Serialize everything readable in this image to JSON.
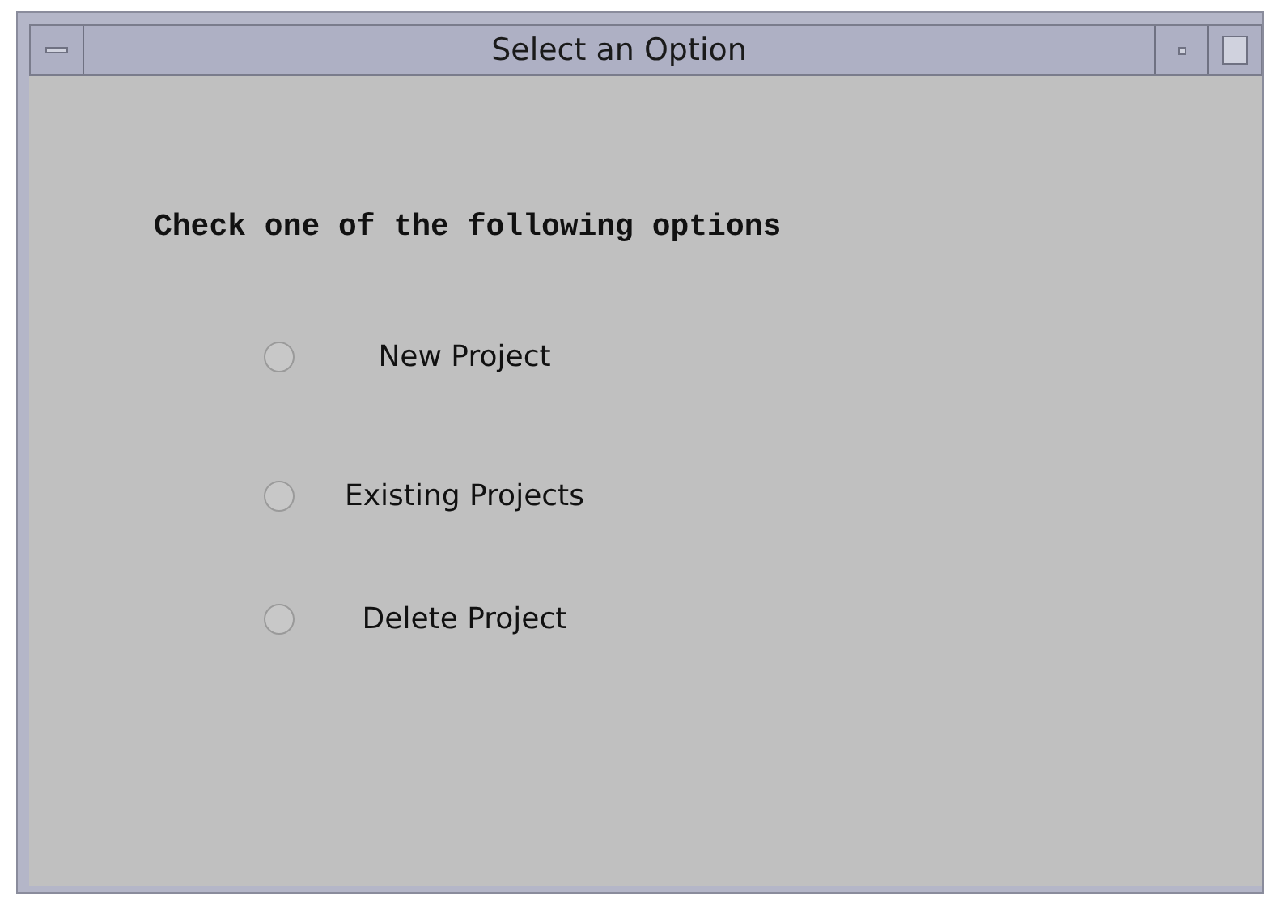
{
  "window": {
    "title": "Select an Option"
  },
  "heading": "Check one of the following options",
  "options": [
    {
      "label": "New Project",
      "selected": false
    },
    {
      "label": "Existing Projects",
      "selected": false
    },
    {
      "label": "Delete Project",
      "selected": false
    }
  ]
}
